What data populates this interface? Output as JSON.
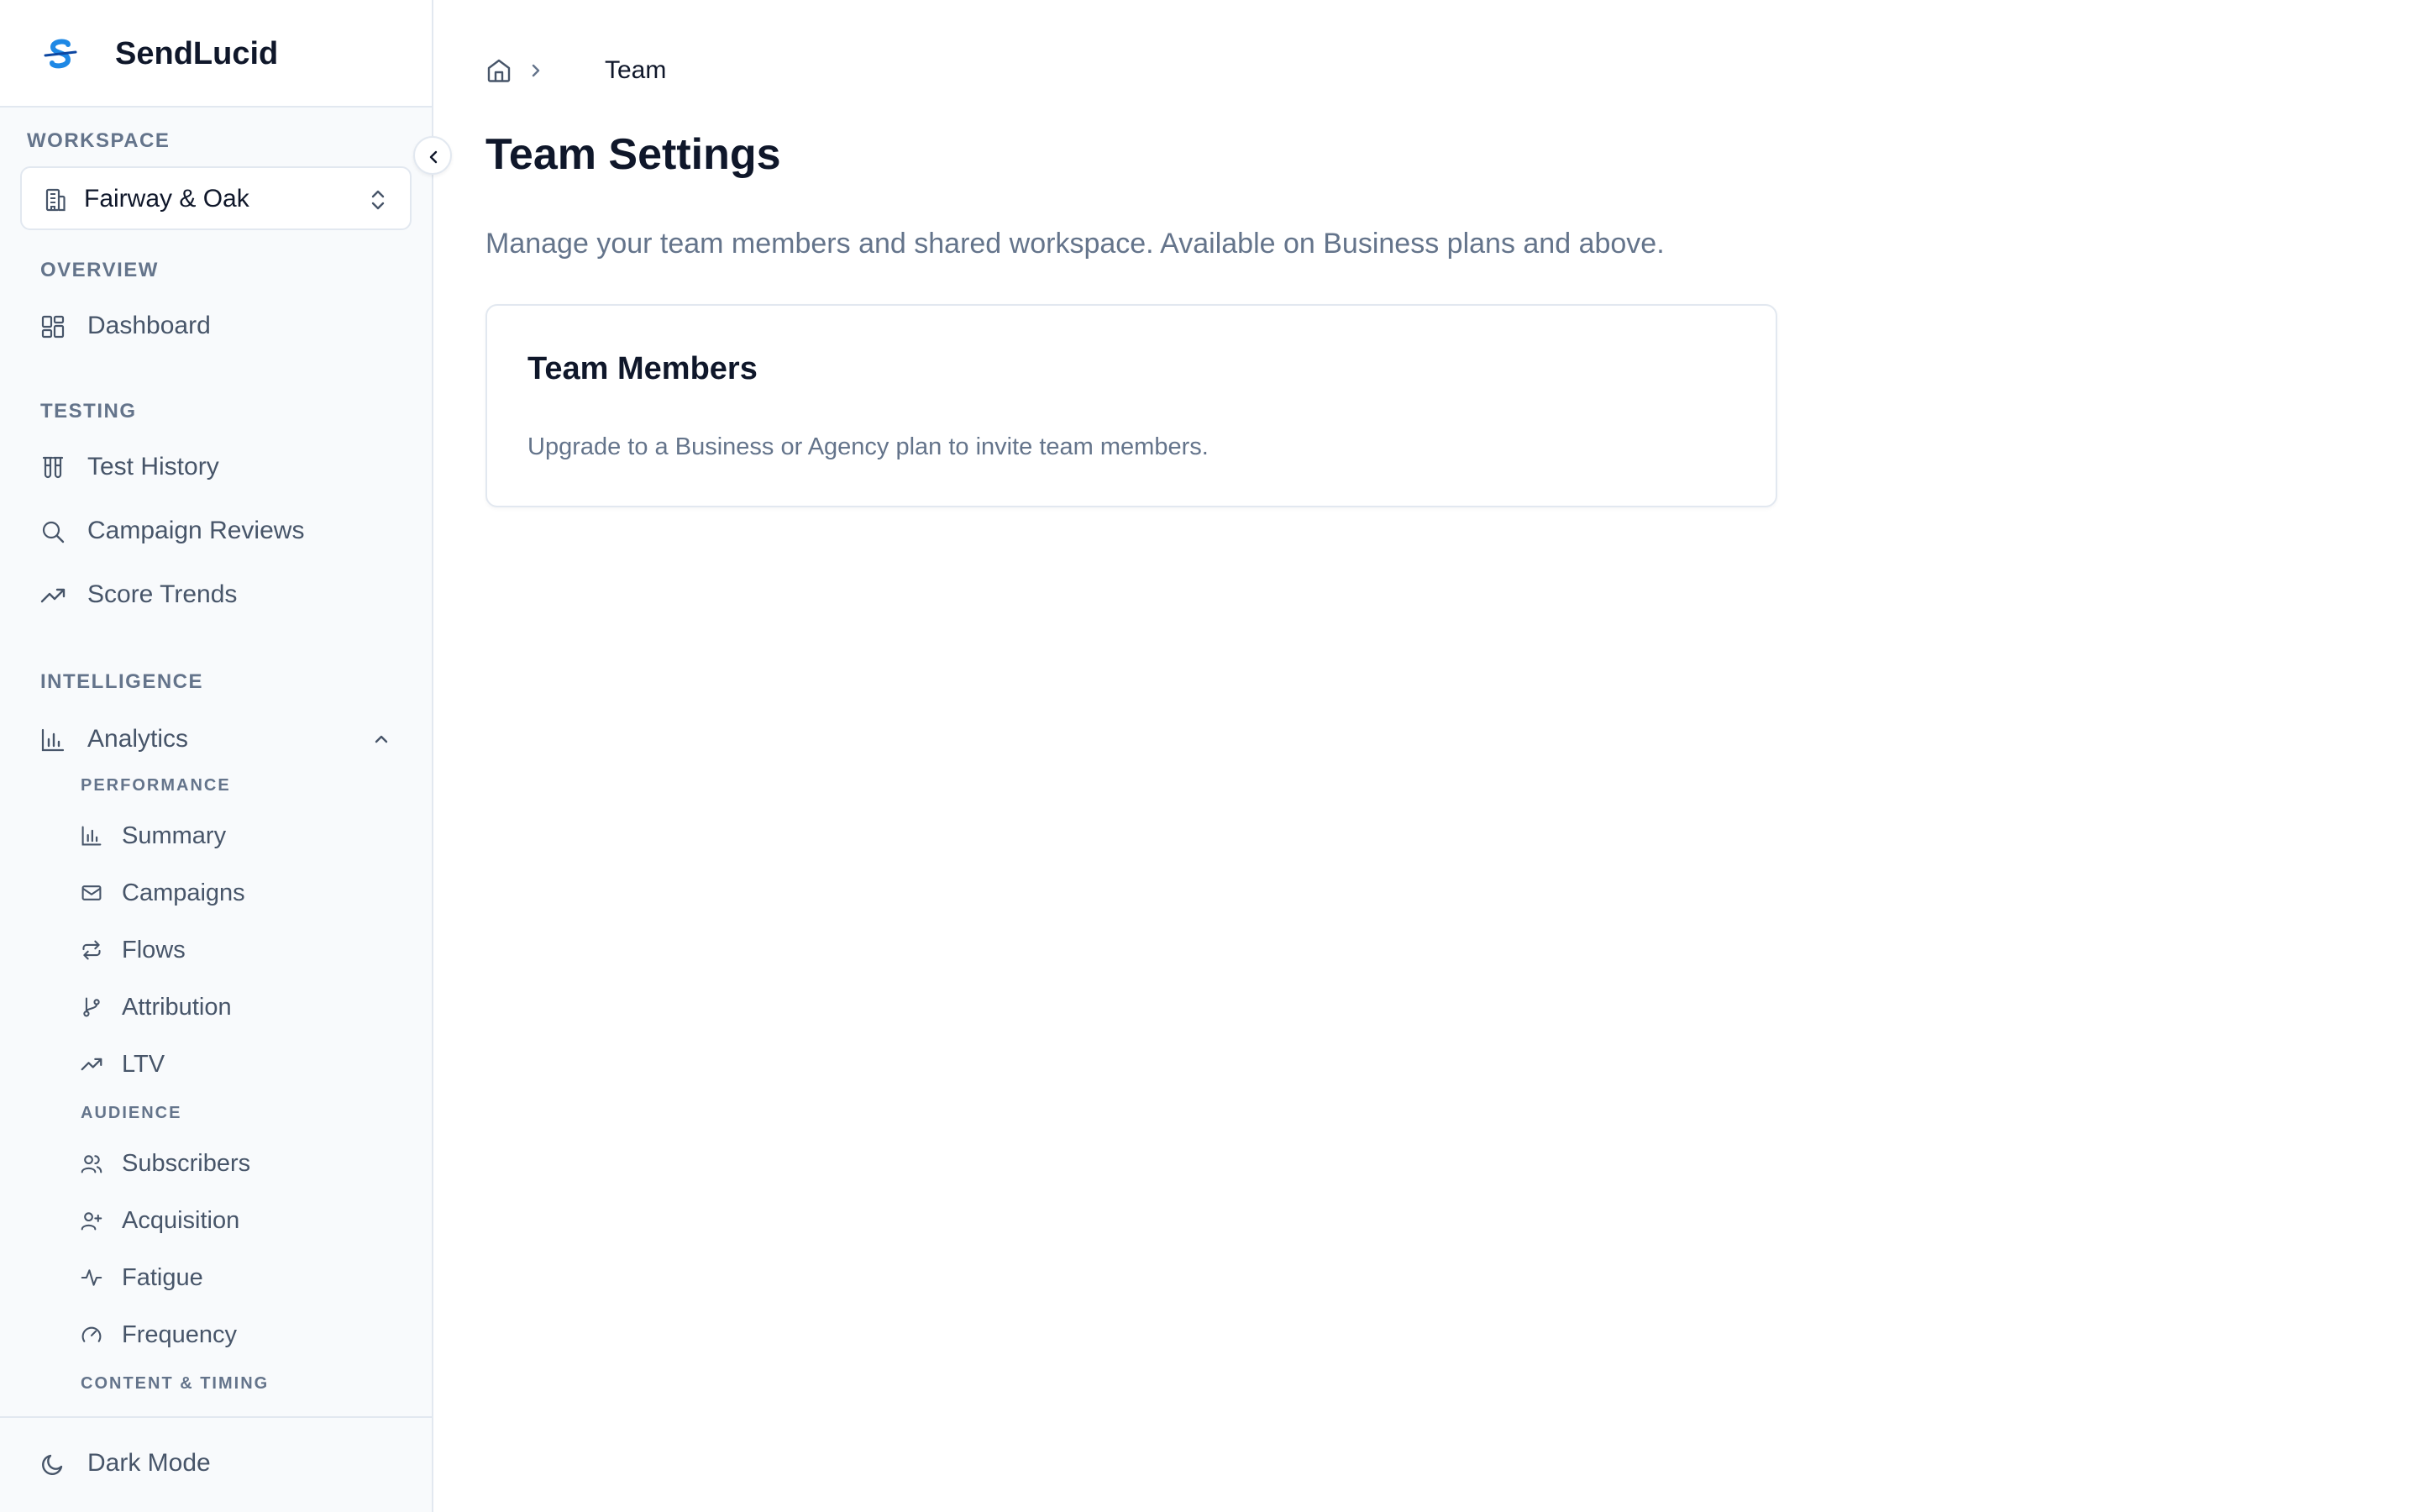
{
  "app": {
    "name": "SendLucid"
  },
  "colors": {
    "accent": "#1e88e5",
    "text": "#0f172a",
    "muted": "#64748b",
    "border": "#e2e8f0"
  },
  "sidebar": {
    "workspace_label": "WORKSPACE",
    "workspace_name": "Fairway & Oak",
    "sections": {
      "overview": "OVERVIEW",
      "testing": "TESTING",
      "intelligence": "INTELLIGENCE"
    },
    "items": {
      "dashboard": {
        "label": "Dashboard",
        "icon": "dashboard-icon"
      },
      "test_history": {
        "label": "Test History",
        "icon": "test-tubes-icon"
      },
      "campaign_reviews": {
        "label": "Campaign Reviews",
        "icon": "search-icon"
      },
      "score_trends": {
        "label": "Score Trends",
        "icon": "trending-up-icon"
      },
      "analytics": {
        "label": "Analytics",
        "icon": "bar-chart-icon",
        "expanded": true
      }
    },
    "analytics_groups": {
      "performance": "PERFORMANCE",
      "audience": "AUDIENCE",
      "content_timing": "CONTENT & TIMING"
    },
    "analytics_items": {
      "summary": "Summary",
      "campaigns": "Campaigns",
      "flows": "Flows",
      "attribution": "Attribution",
      "ltv": "LTV",
      "subscribers": "Subscribers",
      "acquisition": "Acquisition",
      "fatigue": "Fatigue",
      "frequency": "Frequency"
    },
    "footer": {
      "dark_mode": "Dark Mode"
    }
  },
  "main": {
    "breadcrumb": {
      "current": "Team"
    },
    "title": "Team Settings",
    "description": "Manage your team members and shared workspace. Available on Business plans and above.",
    "card": {
      "title": "Team Members",
      "text": "Upgrade to a Business or Agency plan to invite team members."
    }
  }
}
